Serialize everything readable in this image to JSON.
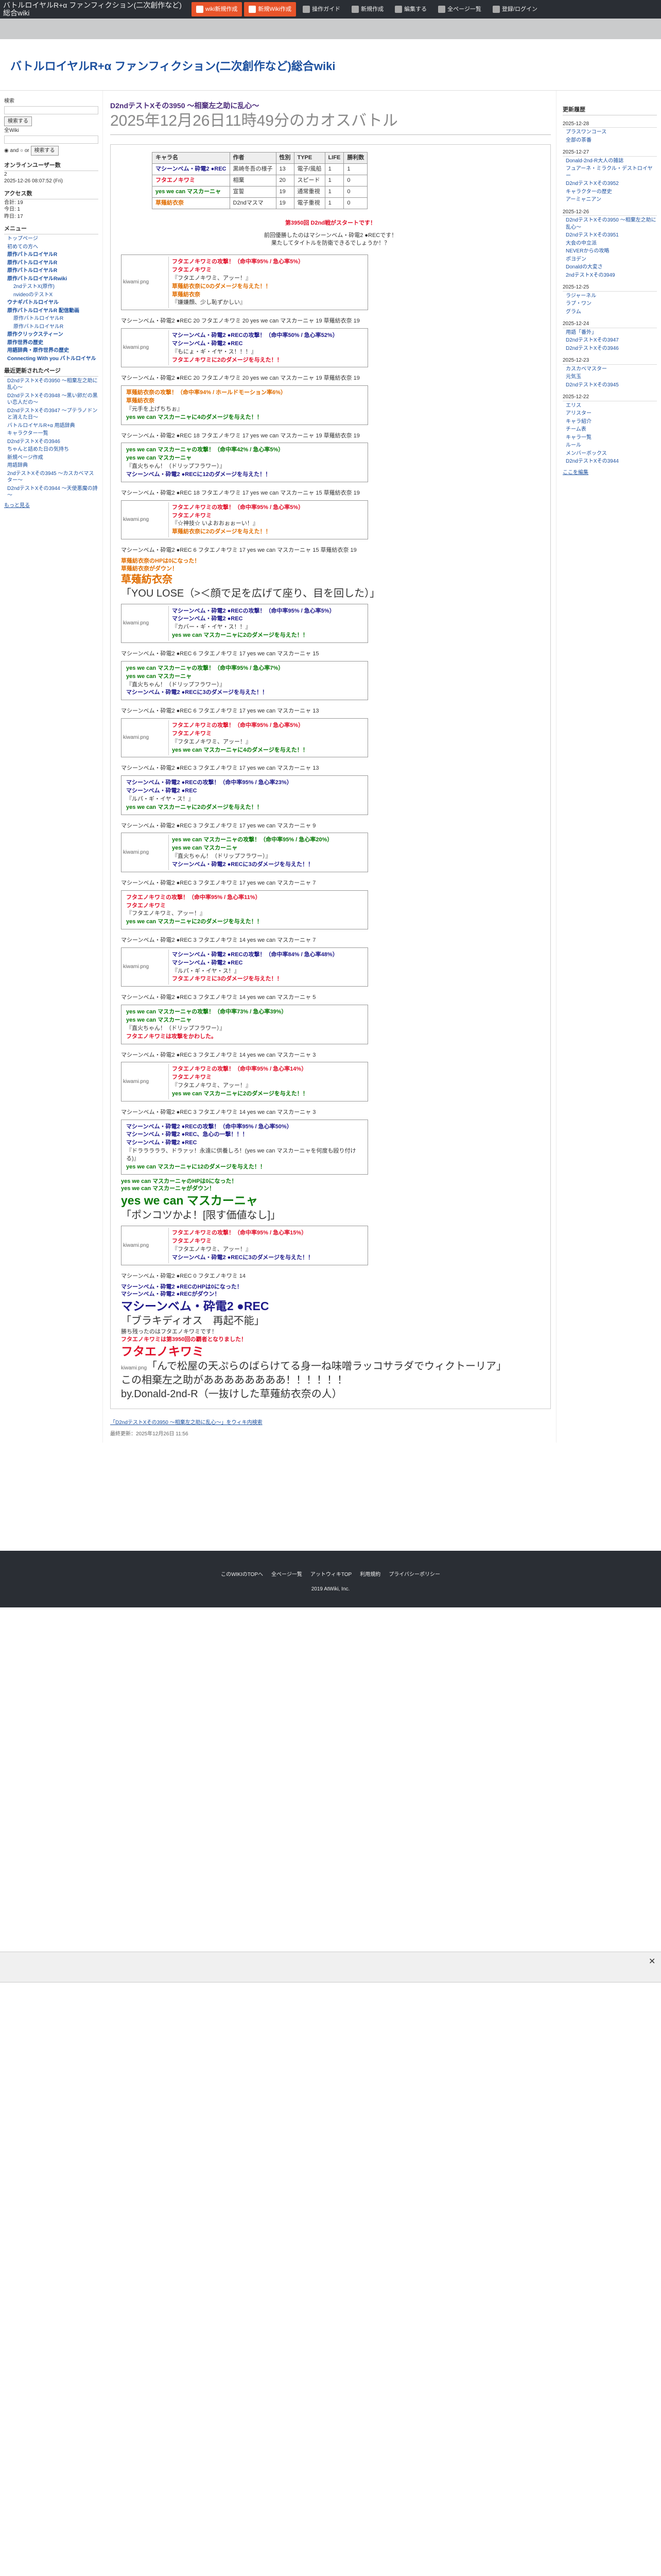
{
  "topbar": {
    "site_title": "バトルロイヤルR+α ファンフィクション(二次創作など)総合wiki",
    "buttons": [
      {
        "label": "wiki新規作成",
        "hi": true
      },
      {
        "label": "新規Wiki作成",
        "hi": true
      },
      {
        "label": "操作ガイド",
        "hi": false
      },
      {
        "label": "新規作成",
        "hi": false
      },
      {
        "label": "編集する",
        "hi": false
      },
      {
        "label": "全ページ一覧",
        "hi": false
      },
      {
        "label": "登録/ログイン",
        "hi": false
      }
    ]
  },
  "header": {
    "title": "バトルロイヤルR+α ファンフィクション(二次創作など)総合wiki"
  },
  "left": {
    "search_label": "検索",
    "search_btn": "検索する",
    "wiki_label": "全Wiki",
    "and": "and",
    "or": "or",
    "online_title": "オンラインユーザー数",
    "online_value": "2",
    "updated": "2025-12-26 08:07:52 (Fri)",
    "access_title": "アクセス数",
    "access_total": "合計: 19",
    "access_today": "今日: 1",
    "access_yesterday": "昨日: 17",
    "menu_title": "メニュー",
    "menu": [
      {
        "t": "トップページ",
        "c": ""
      },
      {
        "t": "初めての方へ",
        "c": ""
      },
      {
        "t": "原作バトルロイヤルR",
        "c": "b"
      },
      {
        "t": "原作バトルロイヤルR",
        "c": "b"
      },
      {
        "t": "原作バトルロイヤルR",
        "c": "b"
      },
      {
        "t": "原作バトルロイヤルRwiki",
        "c": "b"
      },
      {
        "t": "2ndテストX(原作)",
        "c": "sub"
      },
      {
        "t": "nvideoのテストX",
        "c": "sub"
      },
      {
        "t": "ウナギバトルロイヤル",
        "c": "b"
      },
      {
        "t": "原作バトルロイヤルR 配信動画",
        "c": "b"
      },
      {
        "t": "原作バトルロイヤルR",
        "c": "sub"
      },
      {
        "t": "原作バトルロイヤルR",
        "c": "sub"
      },
      {
        "t": "原作クリックスティーン",
        "c": "b"
      },
      {
        "t": "原作世界の歴史",
        "c": "b"
      },
      {
        "t": "用語辞典・原作世界の歴史",
        "c": "b"
      },
      {
        "t": "Connecting With you バトルロイヤル",
        "c": "b"
      }
    ],
    "recent_title": "最近更新されたページ",
    "recent": [
      "D2ndテストXその3950 ～相棄左之助に乱心～",
      "D2ndテストXその3948 ～黒い卵だの黒い恋人だの～",
      "D2ndテストXその3947 ～プテラノドンと消えた日～",
      "バトルロイヤルR+α 用語辞典",
      "キャラクター一覧",
      "D2ndテストXその3946",
      "ちゃんと詰めた日の気持ち",
      "新規ページ作成",
      "用語辞典",
      "2ndテストXその3945 ～カスカベマスター～",
      "D2ndテストXその3944 ～天使悪魔の詩～"
    ],
    "more": "もっと見る"
  },
  "page": {
    "title": "D2ndテストXその3950 ～相棄左之助に乱心～",
    "subtitle": "2025年12月26日11時49分のカオスバトル"
  },
  "chartable": {
    "headers": [
      "キャラ名",
      "作者",
      "性別",
      "TYPE",
      "LIFE",
      "勝利数"
    ],
    "rows": [
      [
        "マシーンベム・砕電2 ●REC",
        "黒崎冬吾の様子",
        "13",
        "電子/風船",
        "1",
        "1"
      ],
      [
        "フタエノキワミ",
        "相棄",
        "20",
        "スピード",
        "1",
        "0"
      ],
      [
        "yes we can マスカーニャ",
        "宣誓",
        "19",
        "通常重視",
        "1",
        "0"
      ],
      [
        "草薙紡衣奈",
        "D2ndマスマ",
        "19",
        "電子重視",
        "1",
        "0"
      ]
    ]
  },
  "intro": {
    "line1": "第3950回 D2nd戦がスタートです！",
    "line2": "前回優勝したのはマシーンベム・砕電2 ●RECです！",
    "line3": "果たしてタイトルを防衛できるでしょうか！？"
  },
  "av": "kiwami.png",
  "turns": [
    {
      "label": "残り体力：",
      "line": "マシーンベム・砕電2 ●REC 20 フタエノキワミ 20 yes we can マスカーニャ 19 草薙紡衣奈 19"
    },
    {
      "label": "残り体力：",
      "line": "マシーンベム・砕電2 ●REC 20 フタエノキワミ 20 yes we can マスカーニャ 19 草薙紡衣奈 19"
    },
    {
      "label": "残り体力：",
      "line": "マシーンベム・砕電2 ●REC 18 フタエノキワミ 17 yes we can マスカーニャ 19 草薙紡衣奈 19"
    },
    {
      "label": "残り体力：",
      "line": "マシーンベム・砕電2 ●REC 18 フタエノキワミ 17 yes we can マスカーニャ 15 草薙紡衣奈 19"
    },
    {
      "label": "残り体力：",
      "line": "マシーンベム・砕電2 ●REC 6 フタエノキワミ 17 yes we can マスカーニャ 15 草薙紡衣奈 19"
    },
    {
      "label": "残り体力：",
      "line": "マシーンベム・砕電2 ●REC 6 フタエノキワミ 17 yes we can マスカーニャ 15 草薙紡衣奈 17"
    }
  ],
  "cards": [
    {
      "lines": [
        "フタエノキワミの攻撃！（命中率95% / 急心率5%）",
        "フタエノキワミ",
        "『フタエノキワミ、アッー！』",
        "草薙紡衣奈に0のダメージを与えた！！",
        "草薙紡衣奈",
        "『嫌嫌顔、少し恥ずかしい』"
      ]
    },
    {
      "lines": [
        "マシーンベム・砕電2 ●RECの攻撃！（命中率50% / 急心率52%）",
        "マシーンベム・砕電2 ●REC",
        "『もにょ・ギ・イヤ・ス！！！』",
        "フタエノキワミに2のダメージを与えた！！"
      ]
    },
    {
      "lines": [
        "草薙紡衣奈の攻撃！（命中率94% / ホールドモーション率6%）",
        "草薙紡衣奈",
        "『元手を上げちちぉ』",
        "yes we can マスカーニャに4のダメージを与えた！！"
      ]
    },
    {
      "lines": [
        "yes we can マスカーニャの攻撃！（命中率42% / 急心率5%）",
        "yes we can マスカーニャ",
        "『直火ちゃん！（ドリップフラワー）』",
        "マシーンベム・砕電2 ●RECに12のダメージを与えた！！"
      ]
    },
    {
      "lines": [
        "フタエノキワミの攻撃！（命中率95% / 急心率5%）",
        "フタエノキワミ",
        "『☆神技☆ いよおおぉぉーい！』",
        "草薙紡衣奈に2のダメージを与えた！！"
      ]
    }
  ],
  "rest": {
    "sentence1": "草薙紡衣奈のHPは0になった！",
    "sentence2": "草薙紡衣奈がダウン！",
    "lose_name": "草薙紡衣奈",
    "lose_quote": "「YOU LOSE（>＜顔で足を広げて座り、目を回した）」",
    "later_label": "残り体力：",
    "later_turns": [
      "マシーンベム・砕電2 ●REC 6 フタエノキワミ 17 yes we can マスカーニャ 15",
      "マシーンベム・砕電2 ●REC 6 フタエノキワミ 17 yes we can マスカーニャ 13",
      "マシーンベム・砕電2 ●REC 3 フタエノキワミ 17 yes we can マスカーニャ 13",
      "マシーンベム・砕電2 ●REC 3 フタエノキワミ 17 yes we can マスカーニャ 9",
      "マシーンベム・砕電2 ●REC 3 フタエノキワミ 17 yes we can マスカーニャ 7",
      "マシーンベム・砕電2 ●REC 3 フタエノキワミ 14 yes we can マスカーニャ 7",
      "マシーンベム・砕電2 ●REC 3 フタエノキワミ 14 yes we can マスカーニャ 5",
      "マシーンベム・砕電2 ●REC 3 フタエノキワミ 14 yes we can マスカーニャ 3"
    ],
    "mid_cards": [
      [
        "マシーンベム・砕電2 ●RECの攻撃！（命中率95% / 急心率5%）",
        "マシーンベム・砕電2 ●REC",
        "『カバー・ギ・イヤ・ス！！』",
        "yes we can マスカーニャに2のダメージを与えた！！"
      ],
      [
        "yes we can マスカーニャの攻撃！（命中率95% / 急心率7%）",
        "yes we can マスカーニャ",
        "『直火ちゃん！（ドリップフラワー）』",
        "マシーンベム・砕電2 ●RECに3のダメージを与えた！！"
      ],
      [
        "フタエノキワミの攻撃！（命中率95% / 急心率5%）",
        "フタエノキワミ",
        "『フタエノキワミ、アッー！』",
        "yes we can マスカーニャに4のダメージを与えた！！"
      ],
      [
        "マシーンベム・砕電2 ●RECの攻撃！（命中率95% / 急心率23%）",
        "マシーンベム・砕電2 ●REC",
        "『ルパ・ギ・イヤ・ス！』",
        "yes we can マスカーニャに2のダメージを与えた！！"
      ],
      [
        "yes we can マスカーニャの攻撃！（命中率95% / 急心率20%）",
        "yes we can マスカーニャ",
        "『直火ちゃん！（ドリップフラワー）』",
        "マシーンベム・砕電2 ●RECに3のダメージを与えた！！"
      ],
      [
        "フタエノキワミの攻撃！（命中率95% / 急心率11%）",
        "フタエノキワミ",
        "『フタエノキワミ、アッー！』",
        "yes we can マスカーニャに2のダメージを与えた！！"
      ],
      [
        "マシーンベム・砕電2 ●RECの攻撃！（命中率84% / 急心率48%）",
        "マシーンベム・砕電2 ●REC",
        "『ルパ・ギ・イヤ・ス！』",
        "フタエノキワミに3のダメージを与えた！！"
      ],
      [
        "yes we can マスカーニャの攻撃！（命中率73% / 急心率39%）",
        "yes we can マスカーニャ",
        "『直火ちゃん！（ドリップフラワー）』",
        "フタエノキワミは攻撃をかわした。"
      ],
      [
        "フタエノキワミの攻撃！（命中率95% / 急心率14%）",
        "フタエノキワミ",
        "『フタエノキワミ、アッー！』",
        "yes we can マスカーニャに2のダメージを与えた！！"
      ]
    ],
    "final_card": [
      "マシーンベム・砕電2 ●RECの攻撃！（命中率95% / 急心率50%）",
      "マシーンベム・砕電2 ●REC、急心の一撃！！！",
      "マシーンベム・砕電2 ●REC",
      "『ドラララララ、ドラァッ！永遠に供養しろ！(yes we can マスカーニャを何度も殴り付ける)』",
      "yes we can マスカーニャに12のダメージを与えた！！"
    ],
    "masca_down1": "yes we can マスカーニャのHPは0になった！",
    "masca_down2": "yes we can マスカーニャがダウン！",
    "masca_name": "yes we can マスカーニャ",
    "masca_quote": "「ポンコツかよ！[限す価値なし]」",
    "last_card": [
      "フタエノキワミの攻撃！（命中率95% / 急心率15%）",
      "フタエノキワミ",
      "『フタエノキワミ、アッー！』",
      "マシーンベム・砕電2 ●RECに3のダメージを与えた！！"
    ],
    "last_turn": "マシーンベム・砕電2 ●REC 0 フタエノキワミ 14",
    "mech_down1": "マシーンベム・砕電2 ●RECのHPは0になった！",
    "mech_down2": "マシーンベム・砕電2 ●RECがダウン！",
    "mech_name": "マシーンベム・砕電2 ●REC",
    "mech_quote": "「ブラキディオス　再起不能」",
    "winner_pre": "勝ち残ったのはフタエノキワミです！",
    "winner_sub": "フタエノキワミは第3950回の覇者となりました！",
    "winner_name": "フタエノキワミ",
    "winner_img": "kiwami.png",
    "winner_quote": "「んで松屋の天ぷらのばらけてる身一ね味噌ラッコサラダでウィクトーリア」",
    "final_line": "この相棄左之助がああああああああ！！！！！！",
    "credit": "by.Donald-2nd-R（一抜けした草薙紡衣奈の人）",
    "comment_link": "「D2ndテストXその3950 ～相棄左之助に乱心～」をウィキ内検索",
    "lastmod": "最終更新：2025年12月26日 11:56"
  },
  "right": {
    "title": "更新履歴",
    "groups": [
      {
        "date": "2025-12-28",
        "items": [
          "プラスワンコース",
          "全部の茶番"
        ]
      },
      {
        "date": "2025-12-27",
        "items": [
          "Donald-2nd-R大人の雑誌",
          "フュアーネ・ミラクル・デストロイヤー",
          "D2ndテストXその3952",
          "キャラクターの歴史",
          "アーミャニアン"
        ]
      },
      {
        "date": "2025-12-26",
        "items": [
          "D2ndテストXその3950 ～相棄左之助に乱心～",
          "D2ndテストXその3951",
          "大会の中立派",
          "NEVERからの攻略",
          "ポヨデン",
          "Donaldの大変さ",
          "2ndテストXその3949"
        ]
      },
      {
        "date": "2025-12-25",
        "items": [
          "ラジャーネル",
          "ラプ・ワン",
          "グラム"
        ]
      },
      {
        "date": "2025-12-24",
        "items": [
          "用語「番外」",
          "D2ndテストXその3947",
          "D2ndテストXその3946"
        ]
      },
      {
        "date": "2025-12-23",
        "items": [
          "カスカベマスター",
          "元気玉",
          "D2ndテストXその3945"
        ]
      },
      {
        "date": "2025-12-22",
        "items": [
          "エリス",
          "アリスター",
          "キャラ紹介",
          "チーム表",
          "キャラ一覧",
          "ルール",
          "メンバーボックス",
          "D2ndテストXその3944"
        ]
      }
    ],
    "more": "ここを編集"
  },
  "footer": {
    "links": [
      "このWIKIのTOPへ",
      "全ページ一覧",
      "アットウィキTOP",
      "利用規約",
      "プライバシーポリシー"
    ],
    "copy": "2019 AtWiki, Inc."
  }
}
